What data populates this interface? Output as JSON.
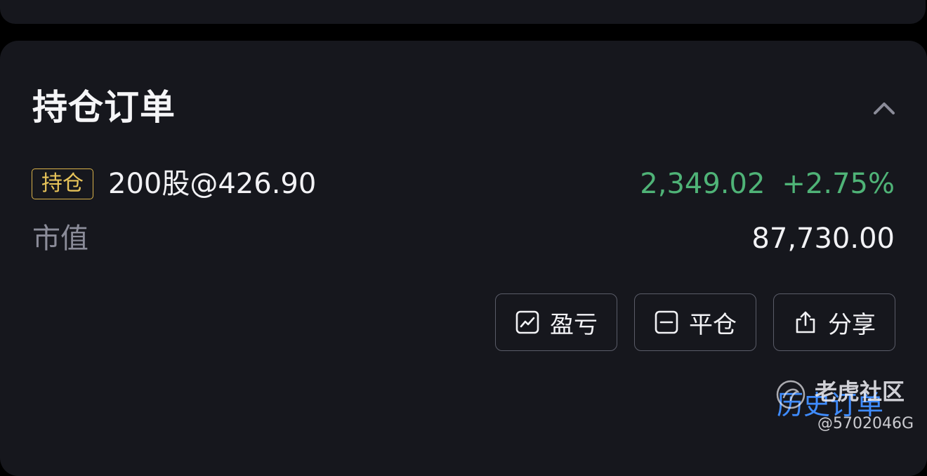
{
  "section": {
    "title": "持仓订单"
  },
  "position": {
    "badge": "持仓",
    "quantity_price": "200股@426.90",
    "pnl_amount": "2,349.02",
    "pnl_percent": "+2.75%",
    "market_value_label": "市值",
    "market_value": "87,730.00"
  },
  "actions": {
    "pnl_label": "盈亏",
    "close_label": "平仓",
    "share_label": "分享"
  },
  "footer": {
    "history_label": "历史订单"
  },
  "watermark": {
    "name": "老虎社区",
    "id": "@5702046G"
  },
  "colors": {
    "background": "#16171d",
    "profit_green": "#4fb377",
    "badge_gold": "#e9c55a",
    "link_blue": "#3f8cff",
    "muted_text": "#8b8c99"
  },
  "icons": {
    "collapse": "chevron-up-icon",
    "pnl": "line-chart-icon",
    "close": "minus-square-icon",
    "share": "share-upload-icon"
  }
}
